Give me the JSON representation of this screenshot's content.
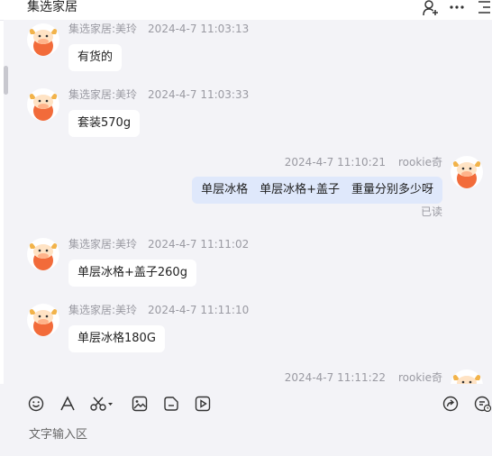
{
  "header": {
    "title": "集选家居"
  },
  "messages": [
    {
      "sender": "集选家居:美玲",
      "time": "2024-4-7 11:03:13",
      "text": "有货的"
    },
    {
      "sender": "集选家居:美玲",
      "time": "2024-4-7 11:03:33",
      "text": "套装570g"
    },
    {
      "sender": "rookie奇",
      "time": "2024-4-7 11:10:21",
      "text": "单层冰格　单层冰格+盖子　重量分别多少呀",
      "status": "已读"
    },
    {
      "sender": "集选家居:美玲",
      "time": "2024-4-7 11:11:02",
      "text": "单层冰格+盖子260g"
    },
    {
      "sender": "集选家居:美玲",
      "time": "2024-4-7 11:11:10",
      "text": "单层冰格180G"
    },
    {
      "sender": "rookie奇",
      "time": "2024-4-7 11:11:22"
    }
  ],
  "input": {
    "placeholder": "文字输入区"
  },
  "icons": {
    "header": [
      "add-contact-icon",
      "more-icon",
      "menu-icon"
    ],
    "toolbar": [
      "emoji-icon",
      "font-icon",
      "scissors-icon",
      "image-icon",
      "file-icon",
      "video-icon",
      "share-icon",
      "chat-history-icon"
    ]
  },
  "colors": {
    "background": "#f3f3f7",
    "incoming_bubble": "#ffffff",
    "outgoing_bubble": "#dfe8fb",
    "meta_text": "#9a9aa2",
    "avatar": "#f26b3a"
  }
}
